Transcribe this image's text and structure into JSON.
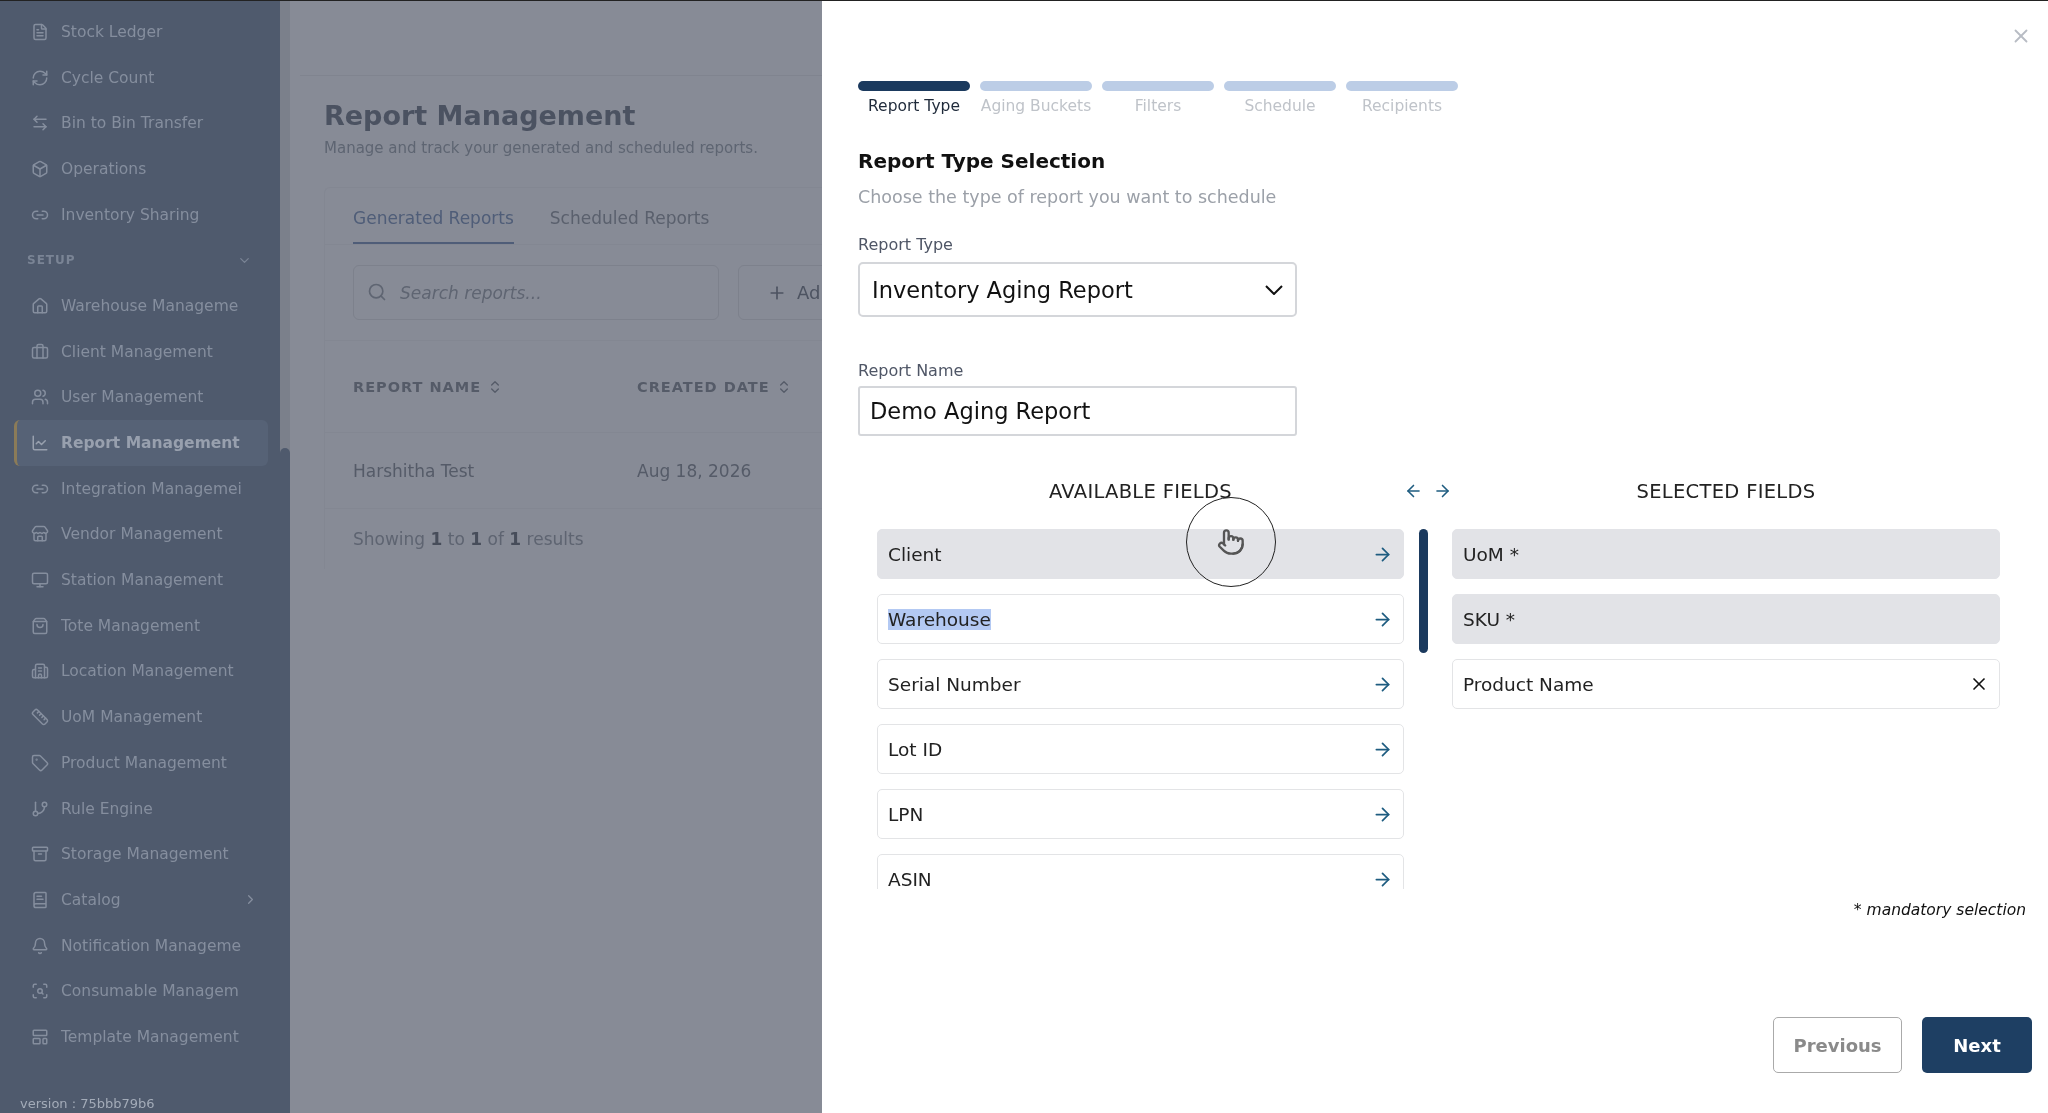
{
  "sidebar": {
    "items_top": [
      "Stock Ledger",
      "Cycle Count",
      "Bin to Bin Transfer",
      "Operations",
      "Inventory Sharing"
    ],
    "section": {
      "label": "SETUP",
      "expanded": true
    },
    "items": [
      {
        "label": "Warehouse Manageme",
        "selected": false,
        "has_children": false
      },
      {
        "label": "Client Management",
        "selected": false,
        "has_children": false
      },
      {
        "label": "User Management",
        "selected": false,
        "has_children": false
      },
      {
        "label": "Report Management",
        "selected": true,
        "has_children": false
      },
      {
        "label": "Integration Managemei",
        "selected": false,
        "has_children": false
      },
      {
        "label": "Vendor Management",
        "selected": false,
        "has_children": false
      },
      {
        "label": "Station Management",
        "selected": false,
        "has_children": false
      },
      {
        "label": "Tote Management",
        "selected": false,
        "has_children": false
      },
      {
        "label": "Location Management",
        "selected": false,
        "has_children": false
      },
      {
        "label": "UoM Management",
        "selected": false,
        "has_children": false
      },
      {
        "label": "Product Management",
        "selected": false,
        "has_children": false
      },
      {
        "label": "Rule Engine",
        "selected": false,
        "has_children": false
      },
      {
        "label": "Storage Management",
        "selected": false,
        "has_children": false
      },
      {
        "label": "Catalog",
        "selected": false,
        "has_children": true
      },
      {
        "label": "Notification Manageme",
        "selected": false,
        "has_children": false
      },
      {
        "label": "Consumable Managem",
        "selected": false,
        "has_children": false
      },
      {
        "label": "Template Management",
        "selected": false,
        "has_children": false
      }
    ],
    "version": "version : 75bbb79b6"
  },
  "page": {
    "title": "Report Management",
    "subtitle": "Manage and track your generated and scheduled reports.",
    "tabs": [
      {
        "label": "Generated Reports",
        "selected": true
      },
      {
        "label": "Scheduled Reports",
        "selected": false
      }
    ],
    "search": {
      "placeholder": "Search reports..."
    },
    "add_button": "Ad",
    "table": {
      "columns": [
        "REPORT NAME",
        "CREATED DATE"
      ],
      "rows": [
        [
          "Harshitha Test",
          "Aug 18, 2026"
        ]
      ]
    },
    "footer": "Showing **1** to **1** of **1** results"
  },
  "modal": {
    "steps": [
      {
        "label": "Report Type",
        "selected": true
      },
      {
        "label": "Aging Buckets",
        "selected": false
      },
      {
        "label": "Filters",
        "selected": false
      },
      {
        "label": "Schedule",
        "selected": false
      },
      {
        "label": "Recipients",
        "selected": false
      }
    ],
    "title": "Report Type Selection",
    "subtitle": "Choose the type of report you want to schedule",
    "report_type": {
      "label": "Report Type",
      "value": "Inventory Aging Report"
    },
    "report_name": {
      "label": "Report Name",
      "value": "Demo Aging Report"
    },
    "available": {
      "heading": "AVAILABLE FIELDS",
      "items": [
        {
          "label": "Client",
          "hovered": true,
          "text_highlighted": false
        },
        {
          "label": "Warehouse",
          "hovered": false,
          "text_highlighted": true
        },
        {
          "label": "Serial Number",
          "hovered": false,
          "text_highlighted": false
        },
        {
          "label": "Lot ID",
          "hovered": false,
          "text_highlighted": false
        },
        {
          "label": "LPN",
          "hovered": false,
          "text_highlighted": false
        },
        {
          "label": "ASIN",
          "hovered": false,
          "text_highlighted": false
        }
      ]
    },
    "selected": {
      "heading": "SELECTED FIELDS",
      "items": [
        {
          "label": "UoM *",
          "mandatory": true
        },
        {
          "label": "SKU *",
          "mandatory": true
        },
        {
          "label": "Product Name",
          "mandatory": false
        }
      ]
    },
    "note": "* mandatory selection",
    "buttons": {
      "previous": "Previous",
      "next": "Next"
    }
  }
}
